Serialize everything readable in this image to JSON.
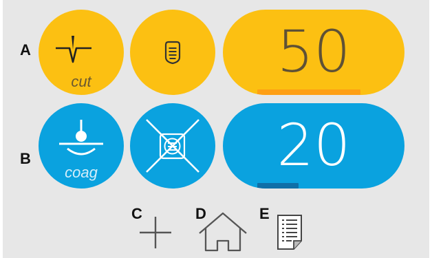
{
  "rows": [
    {
      "label": "A",
      "mode": "cut",
      "mode_icon": "cut-waveform-icon",
      "secondary_icon": "blend-list-icon",
      "value": "50",
      "level_fraction": 0.5,
      "color": "#fcc012",
      "bar_color": "#fe9f15",
      "text_color": "#5f5135"
    },
    {
      "label": "B",
      "mode": "coag",
      "mode_icon": "coag-electrode-icon",
      "secondary_icon": "disabled-crossed-icon",
      "value": "20",
      "level_fraction": 0.2,
      "color": "#0aa2df",
      "bar_color": "#0f6fa7",
      "text_color": "#ffffff"
    }
  ],
  "controls": [
    {
      "label": "C",
      "icon": "plus-icon"
    },
    {
      "label": "D",
      "icon": "home-icon"
    },
    {
      "label": "E",
      "icon": "notes-document-icon"
    }
  ]
}
